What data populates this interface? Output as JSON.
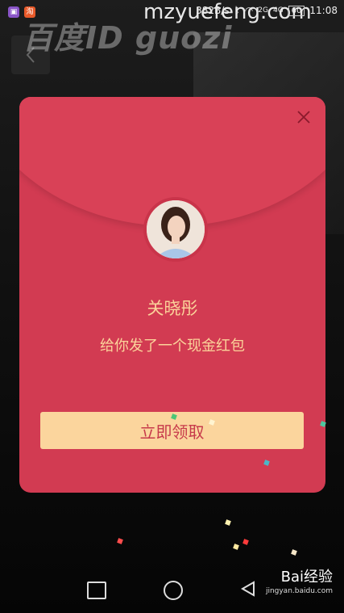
{
  "status_bar": {
    "speed": "382B/s",
    "net2g": "2G",
    "net4g": "4G",
    "battery": "60",
    "time": "11:08",
    "app_icon_1": "image-icon",
    "app_icon_2": "淘"
  },
  "watermarks": {
    "left": "百度ID guozi",
    "top": "mzyuefeng.com"
  },
  "red_packet": {
    "sender_name": "关晓彤",
    "message": "给你发了一个现金红包",
    "claim_label": "立即领取",
    "colors": {
      "card": "#d23b52",
      "gold_text": "#fbd39a",
      "button_bg": "#fbd59d",
      "button_text": "#c73a4b"
    }
  },
  "baidu": {
    "label": "Bai经验",
    "sub": "jingyan.baidu.com"
  }
}
